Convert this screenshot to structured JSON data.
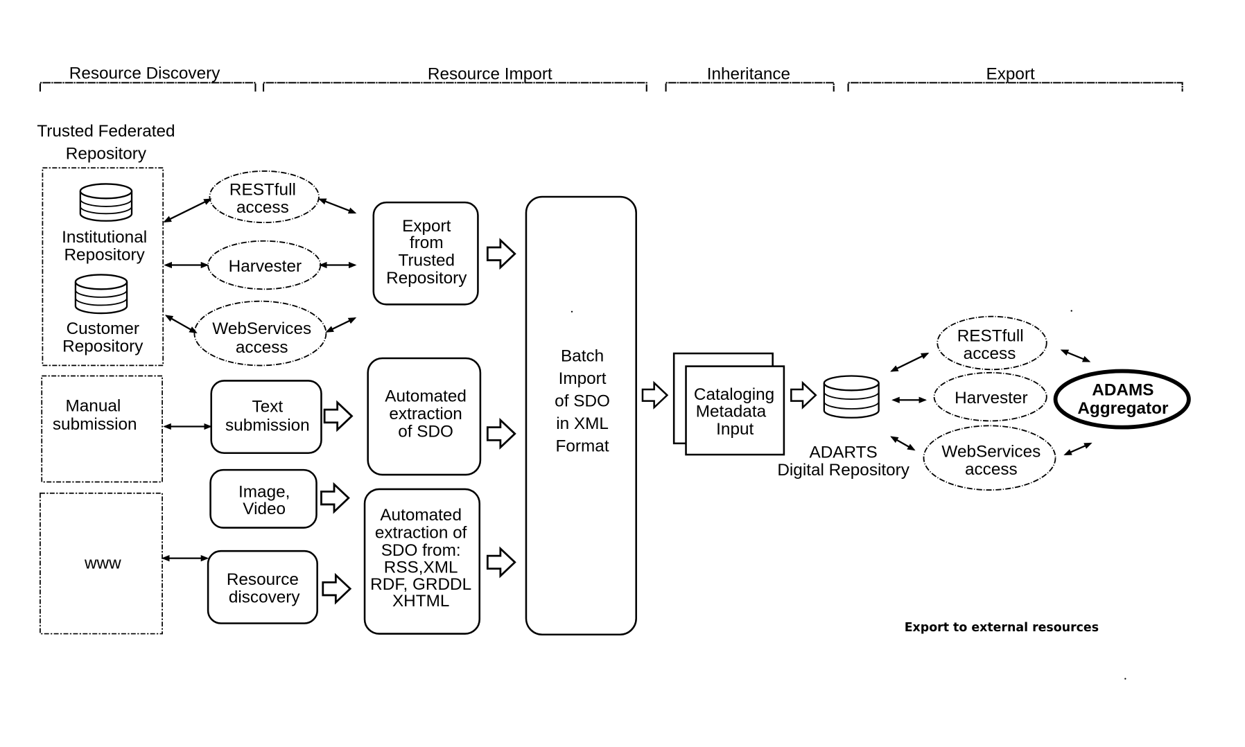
{
  "phases": [
    {
      "label": "Resource Discovery"
    },
    {
      "label": "Resource Import"
    },
    {
      "label": "Inheritance"
    },
    {
      "label": "Export"
    }
  ],
  "trusted": {
    "title_lines": [
      "Trusted Federated",
      "Repository"
    ],
    "institutional_lines": [
      "Institutional",
      "Repository"
    ],
    "customer_lines": [
      "Customer",
      "Repository"
    ]
  },
  "manual": {
    "lines": [
      "Manual",
      "submission"
    ]
  },
  "www": {
    "label": "www"
  },
  "access_left": {
    "restful": [
      "RESTfull",
      "access"
    ],
    "harvester": [
      "Harvester"
    ],
    "webservices": [
      "WebServices",
      "access"
    ]
  },
  "submission": {
    "text": [
      "Text",
      "submission"
    ],
    "image": [
      "Image,",
      "Video"
    ],
    "discovery": [
      "Resource",
      "discovery"
    ]
  },
  "import_boxes": {
    "export_trusted": [
      "Export",
      "from",
      "Trusted",
      "Repository"
    ],
    "auto_sdo": [
      "Automated",
      "extraction",
      "of SDO"
    ],
    "auto_sdo_from": [
      "Automated",
      "extraction of",
      "SDO from:",
      "RSS,XML",
      "RDF, GRDDL",
      "XHTML"
    ]
  },
  "batch": {
    "lines": [
      "Batch",
      "Import",
      "of SDO",
      "in XML",
      "Format"
    ]
  },
  "cataloging": {
    "lines": [
      "Cataloging",
      "Metadata",
      "Input"
    ]
  },
  "adarts": {
    "lines": [
      "ADARTS",
      "Digital Repository"
    ]
  },
  "access_right": {
    "restful": [
      "RESTfull",
      "access"
    ],
    "harvester": [
      "Harvester"
    ],
    "webservices": [
      "WebServices",
      "access"
    ]
  },
  "aggregator": {
    "lines": [
      "ADAMS",
      "Aggregator"
    ]
  },
  "footer": {
    "export_note": "Export to external resources"
  }
}
